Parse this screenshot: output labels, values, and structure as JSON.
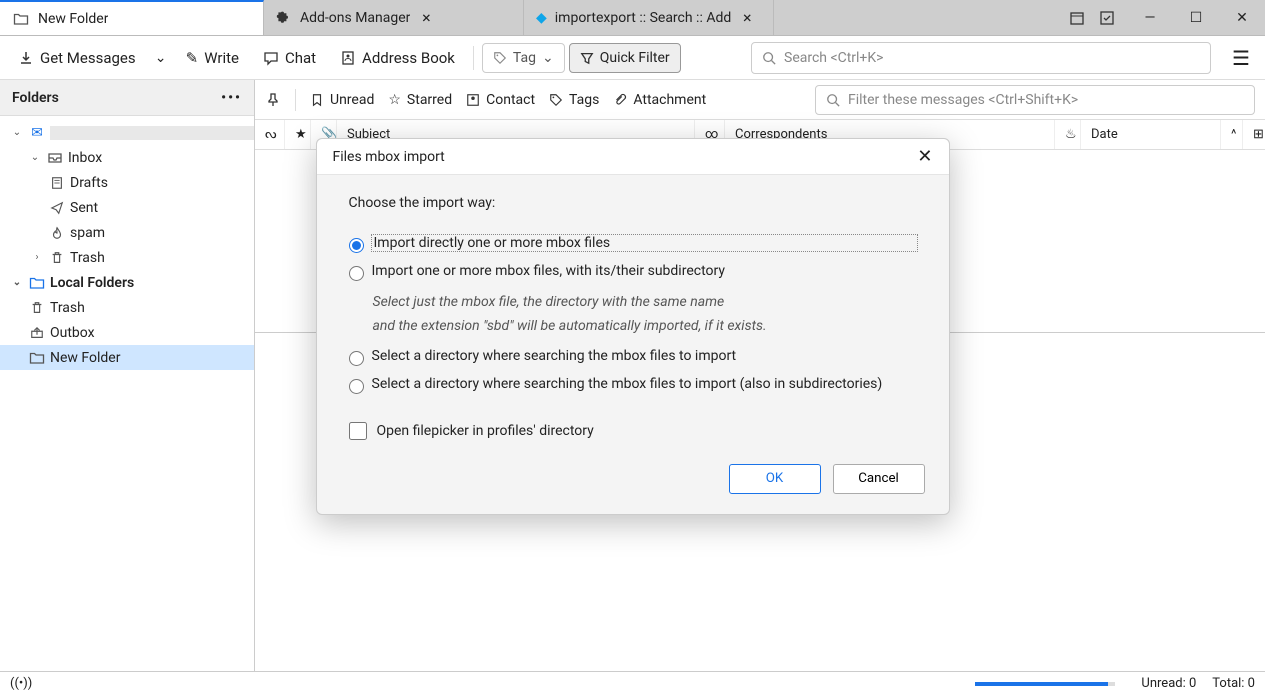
{
  "tabs": [
    {
      "title": "New Folder",
      "icon": "folder"
    },
    {
      "title": "Add-ons Manager",
      "icon": "puzzle"
    },
    {
      "title": "importexport :: Search :: Add",
      "icon": "dropbox"
    }
  ],
  "toolbar": {
    "get_messages": "Get Messages",
    "write": "Write",
    "chat": "Chat",
    "address_book": "Address Book",
    "tag": "Tag",
    "quick_filter": "Quick Filter",
    "search_placeholder": "Search <Ctrl+K>"
  },
  "sidebar": {
    "header": "Folders",
    "account": "",
    "items": [
      {
        "label": "Inbox",
        "icon": "inbox"
      },
      {
        "label": "Drafts",
        "icon": "draft"
      },
      {
        "label": "Sent",
        "icon": "sent"
      },
      {
        "label": "spam",
        "icon": "flame"
      },
      {
        "label": "Trash",
        "icon": "trash"
      }
    ],
    "local_label": "Local Folders",
    "local": [
      {
        "label": "Trash",
        "icon": "trash"
      },
      {
        "label": "Outbox",
        "icon": "outbox"
      },
      {
        "label": "New Folder",
        "icon": "folder"
      }
    ]
  },
  "filterbar": {
    "unread": "Unread",
    "starred": "Starred",
    "contact": "Contact",
    "tags": "Tags",
    "attachment": "Attachment",
    "filter_placeholder": "Filter these messages <Ctrl+Shift+K>"
  },
  "columns": {
    "subject": "Subject",
    "correspondents": "Correspondents",
    "date": "Date"
  },
  "statusbar": {
    "unread": "Unread: 0",
    "total": "Total: 0"
  },
  "dialog": {
    "title": "Files mbox import",
    "intro": "Choose the import way:",
    "opt1": "Import directly one or more mbox files",
    "opt2": "Import one or more mbox files, with its/their subdirectory",
    "opt2_hint1": "Select just the mbox file, the directory with the same name",
    "opt2_hint2": "and the extension \"sbd\" will be automatically imported, if it exists.",
    "opt3": "Select a directory where searching the mbox files to import",
    "opt4": "Select a directory where searching the mbox files to import (also in subdirectories)",
    "checkbox": "Open filepicker in profiles' directory",
    "ok": "OK",
    "cancel": "Cancel"
  }
}
